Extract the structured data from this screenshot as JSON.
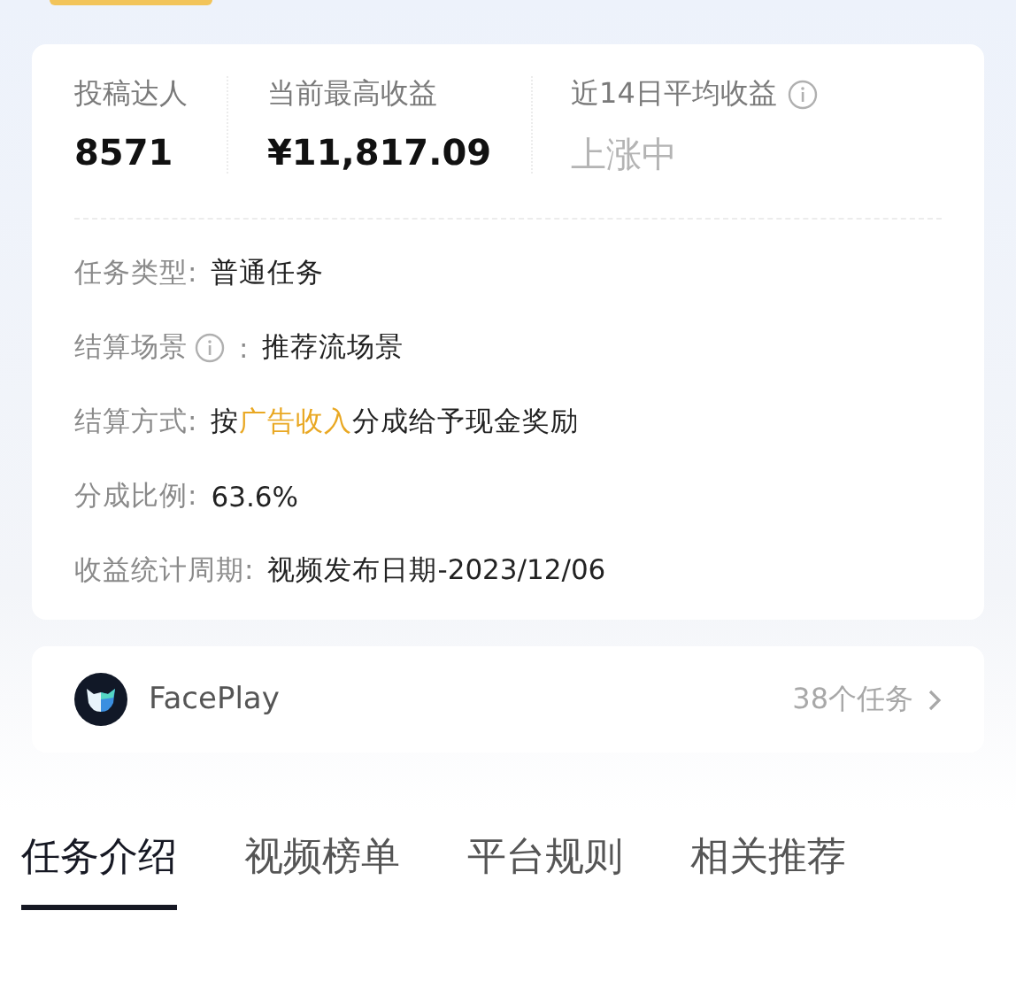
{
  "stats": [
    {
      "label": "投稿达人",
      "info": false,
      "value": "8571",
      "muted": false
    },
    {
      "label": "当前最高收益",
      "info": false,
      "value": "¥11,817.09",
      "muted": false
    },
    {
      "label": "近14日平均收益",
      "info": true,
      "value": "上涨中",
      "muted": true
    }
  ],
  "details": [
    {
      "label": "任务类型:",
      "info": false,
      "value": [
        {
          "text": "普通任务",
          "highlight": false
        }
      ]
    },
    {
      "label": "结算场景",
      "info": true,
      "suffix": ":",
      "value": [
        {
          "text": "推荐流场景",
          "highlight": false
        }
      ]
    },
    {
      "label": "结算方式:",
      "info": false,
      "value": [
        {
          "text": "按",
          "highlight": false
        },
        {
          "text": "广告收入",
          "highlight": true
        },
        {
          "text": "分成给予现金奖励",
          "highlight": false
        }
      ]
    },
    {
      "label": "分成比例:",
      "info": false,
      "value": [
        {
          "text": "63.6%",
          "highlight": false
        }
      ]
    },
    {
      "label": "收益统计周期:",
      "info": false,
      "value": [
        {
          "text": "视频发布日期-2023/12/06",
          "highlight": false
        }
      ]
    }
  ],
  "app": {
    "name": "FacePlay",
    "tasks": "38个任务"
  },
  "tabs": [
    {
      "label": "任务介绍",
      "selected": true
    },
    {
      "label": "视频榜单",
      "selected": false
    },
    {
      "label": "平台规则",
      "selected": false
    },
    {
      "label": "相关推荐",
      "selected": false
    }
  ]
}
